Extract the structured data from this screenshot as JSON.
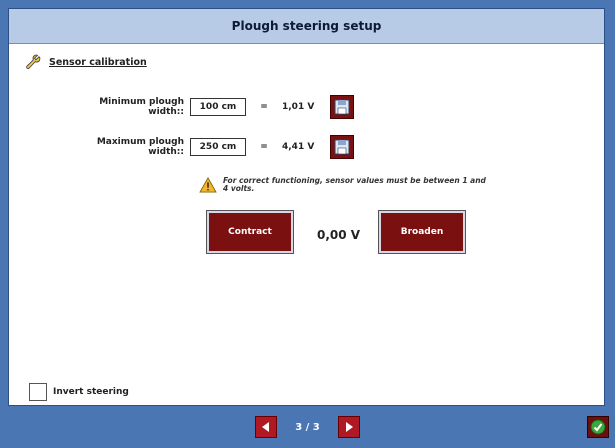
{
  "window": {
    "title": "Plough steering setup"
  },
  "section": {
    "label": "Sensor calibration",
    "icon": "wrench-icon"
  },
  "min_width": {
    "label": "Minimum plough width::",
    "value": "100 cm",
    "equals": "=",
    "voltage": "1,01 V"
  },
  "max_width": {
    "label": "Maximum plough width::",
    "value": "250 cm",
    "equals": "=",
    "voltage": "4,41 V"
  },
  "warning": {
    "text": "For correct functioning, sensor values must be between 1 and 4 volts.",
    "icon": "warning-icon"
  },
  "controls": {
    "contract_label": "Contract",
    "broaden_label": "Broaden",
    "current_voltage": "0,00 V"
  },
  "invert": {
    "label": "Invert steering",
    "checked": false
  },
  "pagination": {
    "current": "3 / 3"
  },
  "colors": {
    "frame_bg": "#4a76b4",
    "title_bg": "#b8cbe6",
    "button_red": "#7a1010",
    "nav_red": "#b01824"
  }
}
